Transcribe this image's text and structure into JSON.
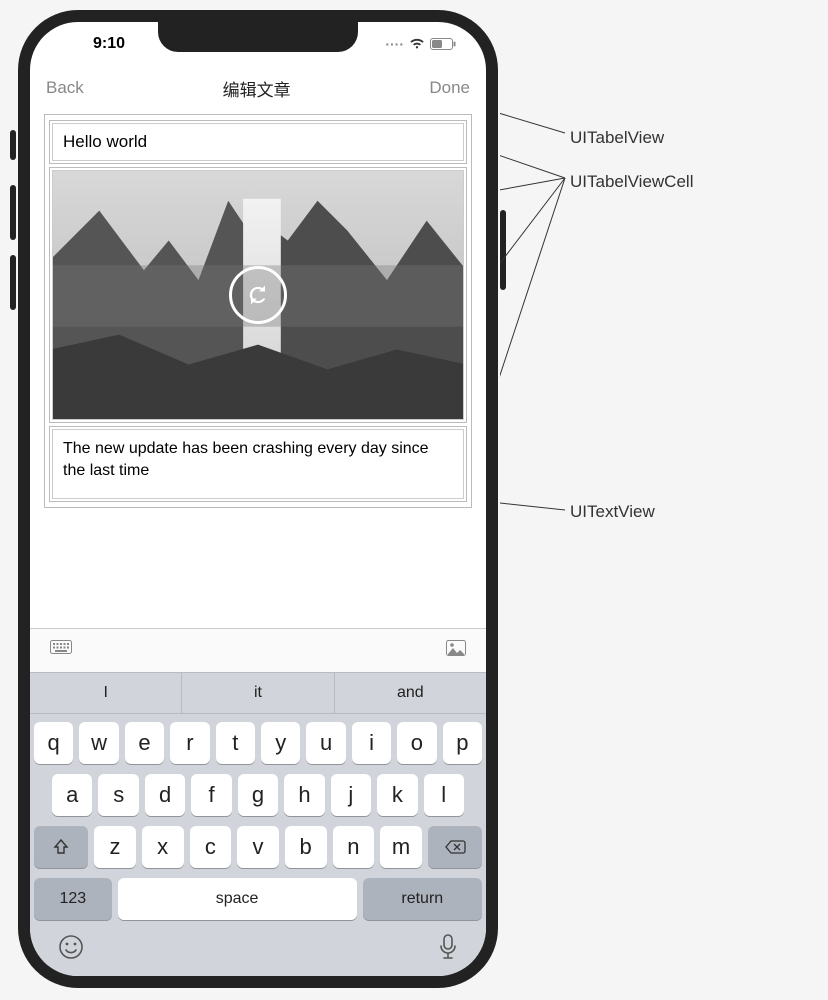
{
  "status": {
    "time": "9:10",
    "wifi": "wifi-icon",
    "battery": "battery-icon",
    "dots": "····"
  },
  "nav": {
    "back": "Back",
    "title": "编辑文章",
    "done": "Done"
  },
  "cells": {
    "title_text": "Hello world",
    "body_text": "The new update has been crashing every day since the last time"
  },
  "toolbar": {
    "kbd_icon": "⌨",
    "img_icon": "🖼"
  },
  "suggest": [
    "I",
    "it",
    "and"
  ],
  "keyboard": {
    "row1": [
      "q",
      "w",
      "e",
      "r",
      "t",
      "y",
      "u",
      "i",
      "o",
      "p"
    ],
    "row2": [
      "a",
      "s",
      "d",
      "f",
      "g",
      "h",
      "j",
      "k",
      "l"
    ],
    "row3": [
      "z",
      "x",
      "c",
      "v",
      "b",
      "n",
      "m"
    ],
    "num": "123",
    "space": "space",
    "ret": "return"
  },
  "bottom": {
    "emoji": "☺",
    "mic": "🎤"
  },
  "annotations": {
    "tableview": "UITabelView",
    "cell": "UITabelViewCell",
    "textview": "UITextView"
  }
}
